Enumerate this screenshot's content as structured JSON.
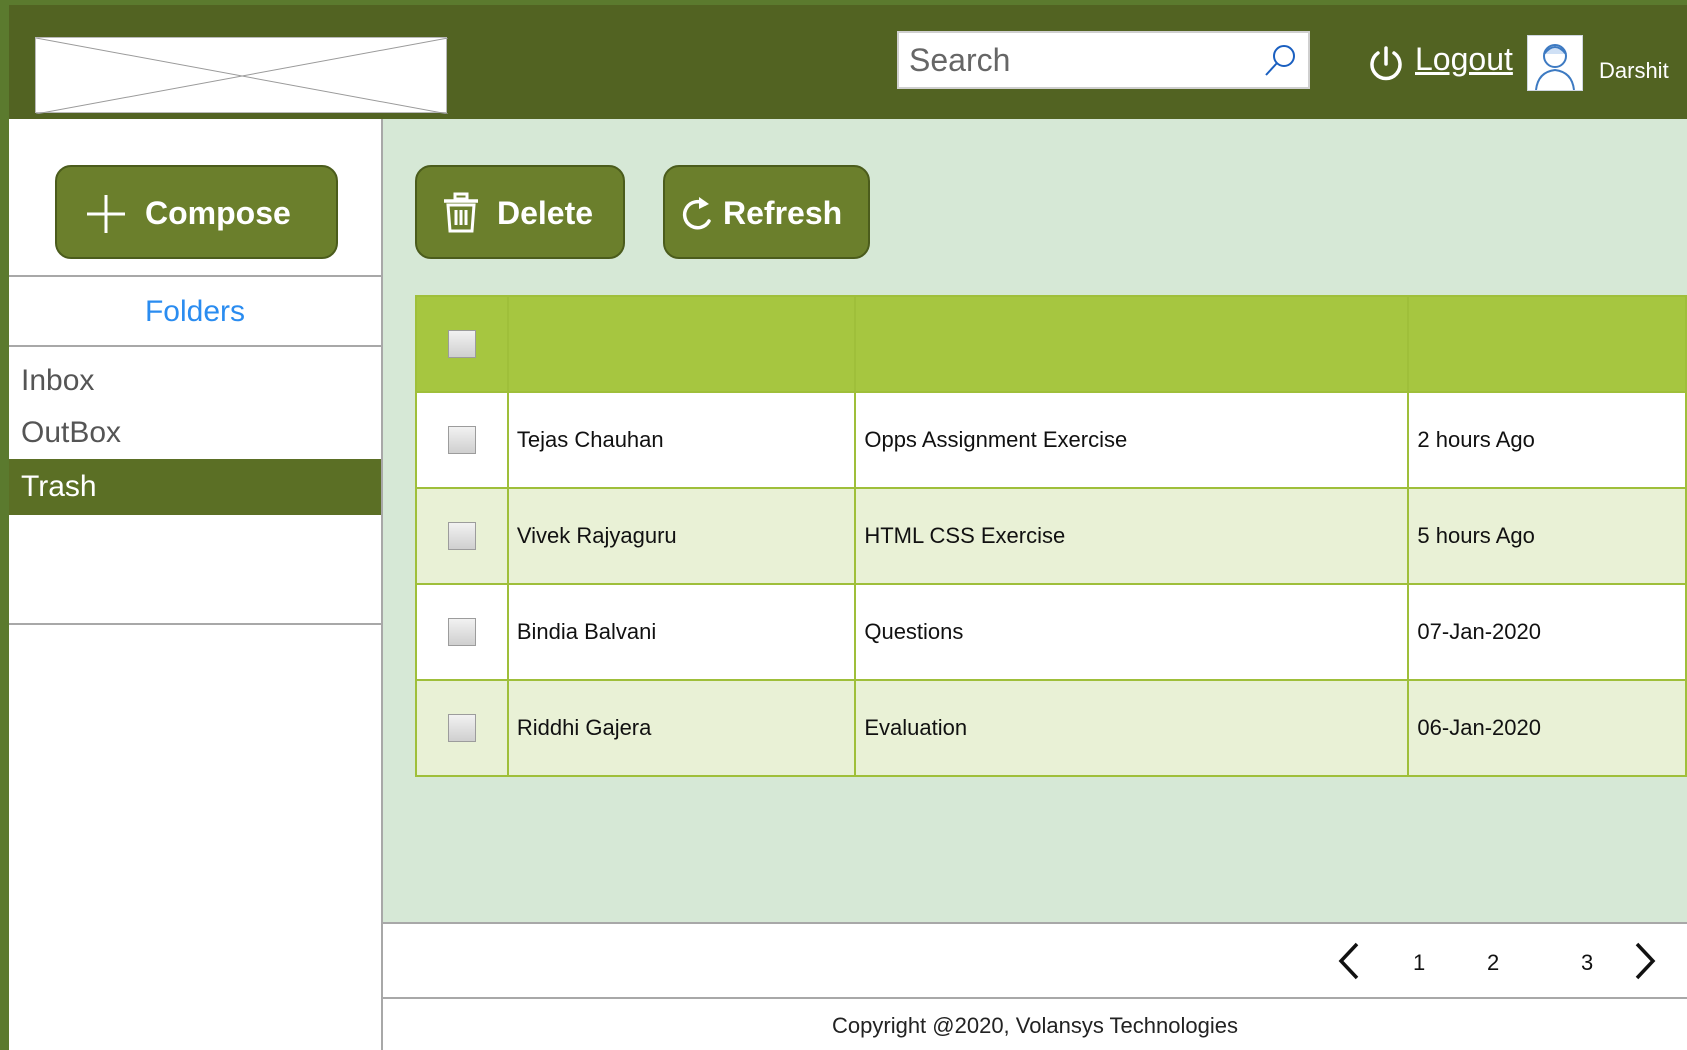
{
  "header": {
    "search_placeholder": "Search",
    "logout_label": "Logout",
    "user_name": "Darshit"
  },
  "sidebar": {
    "compose_label": "Compose",
    "folders_title": "Folders",
    "items": [
      {
        "label": "Inbox",
        "active": false
      },
      {
        "label": "OutBox",
        "active": false
      },
      {
        "label": "Trash",
        "active": true
      }
    ]
  },
  "toolbar": {
    "delete_label": "Delete",
    "refresh_label": "Refresh"
  },
  "messages": [
    {
      "sender": "Tejas Chauhan",
      "subject": "Opps Assignment Exercise",
      "time": "2 hours Ago"
    },
    {
      "sender": "Vivek Rajyaguru",
      "subject": "HTML CSS Exercise",
      "time": "5 hours Ago"
    },
    {
      "sender": "Bindia Balvani",
      "subject": "Questions",
      "time": "07-Jan-2020"
    },
    {
      "sender": "Riddhi Gajera",
      "subject": "Evaluation",
      "time": "06-Jan-2020"
    }
  ],
  "pagination": {
    "pages": [
      "1",
      "2",
      "3"
    ]
  },
  "footer": {
    "copyright": "Copyright @2020, Volansys Technologies"
  },
  "colors": {
    "header_bg": "#526322",
    "button_bg": "#6b7f2c",
    "table_header": "#a6c640",
    "content_bg": "#d6e8d6",
    "link_blue": "#2a8cf0"
  }
}
